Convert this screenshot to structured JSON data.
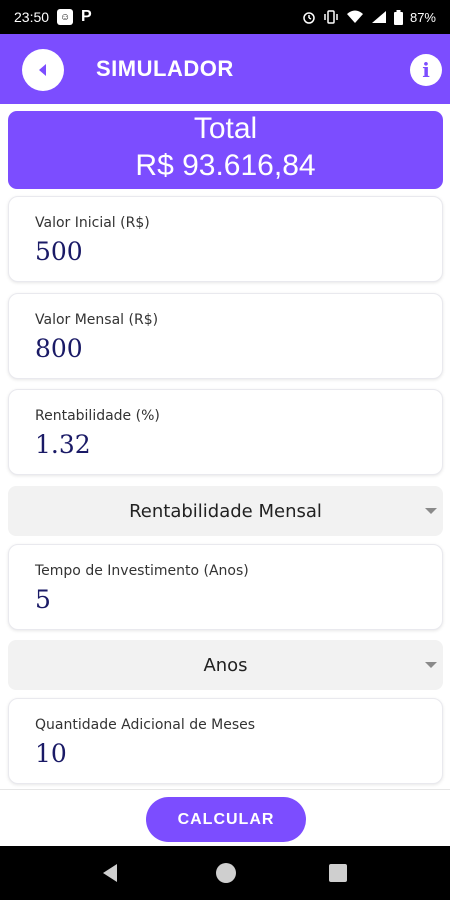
{
  "status_bar": {
    "time": "23:50",
    "battery": "87%",
    "icons": [
      "app-icon",
      "p-icon",
      "alarm-icon",
      "vibrate-icon",
      "wifi-icon",
      "signal-icon",
      "battery-icon"
    ]
  },
  "app_bar": {
    "title": "SIMULADOR",
    "back_icon": "back-arrow-icon",
    "info_icon": "info-icon",
    "info_glyph": "i"
  },
  "total": {
    "label": "Total",
    "value": "R$ 93.616,84"
  },
  "fields": {
    "valor_inicial": {
      "label": "Valor Inicial (R$)",
      "value": "500"
    },
    "valor_mensal": {
      "label": "Valor Mensal (R$)",
      "value": "800"
    },
    "rentabilidade": {
      "label": "Rentabilidade (%)",
      "value": "1.32"
    },
    "tempo": {
      "label": "Tempo de Investimento (Anos)",
      "value": "5"
    },
    "meses": {
      "label": "Quantidade Adicional de Meses",
      "value": "10"
    }
  },
  "dropdowns": {
    "rentabilidade_tipo": "Rentabilidade Mensal",
    "tempo_unidade": "Anos"
  },
  "actions": {
    "calcular": "CALCULAR"
  },
  "colors": {
    "primary": "#7c4dff",
    "value_text": "#1a1a66"
  }
}
